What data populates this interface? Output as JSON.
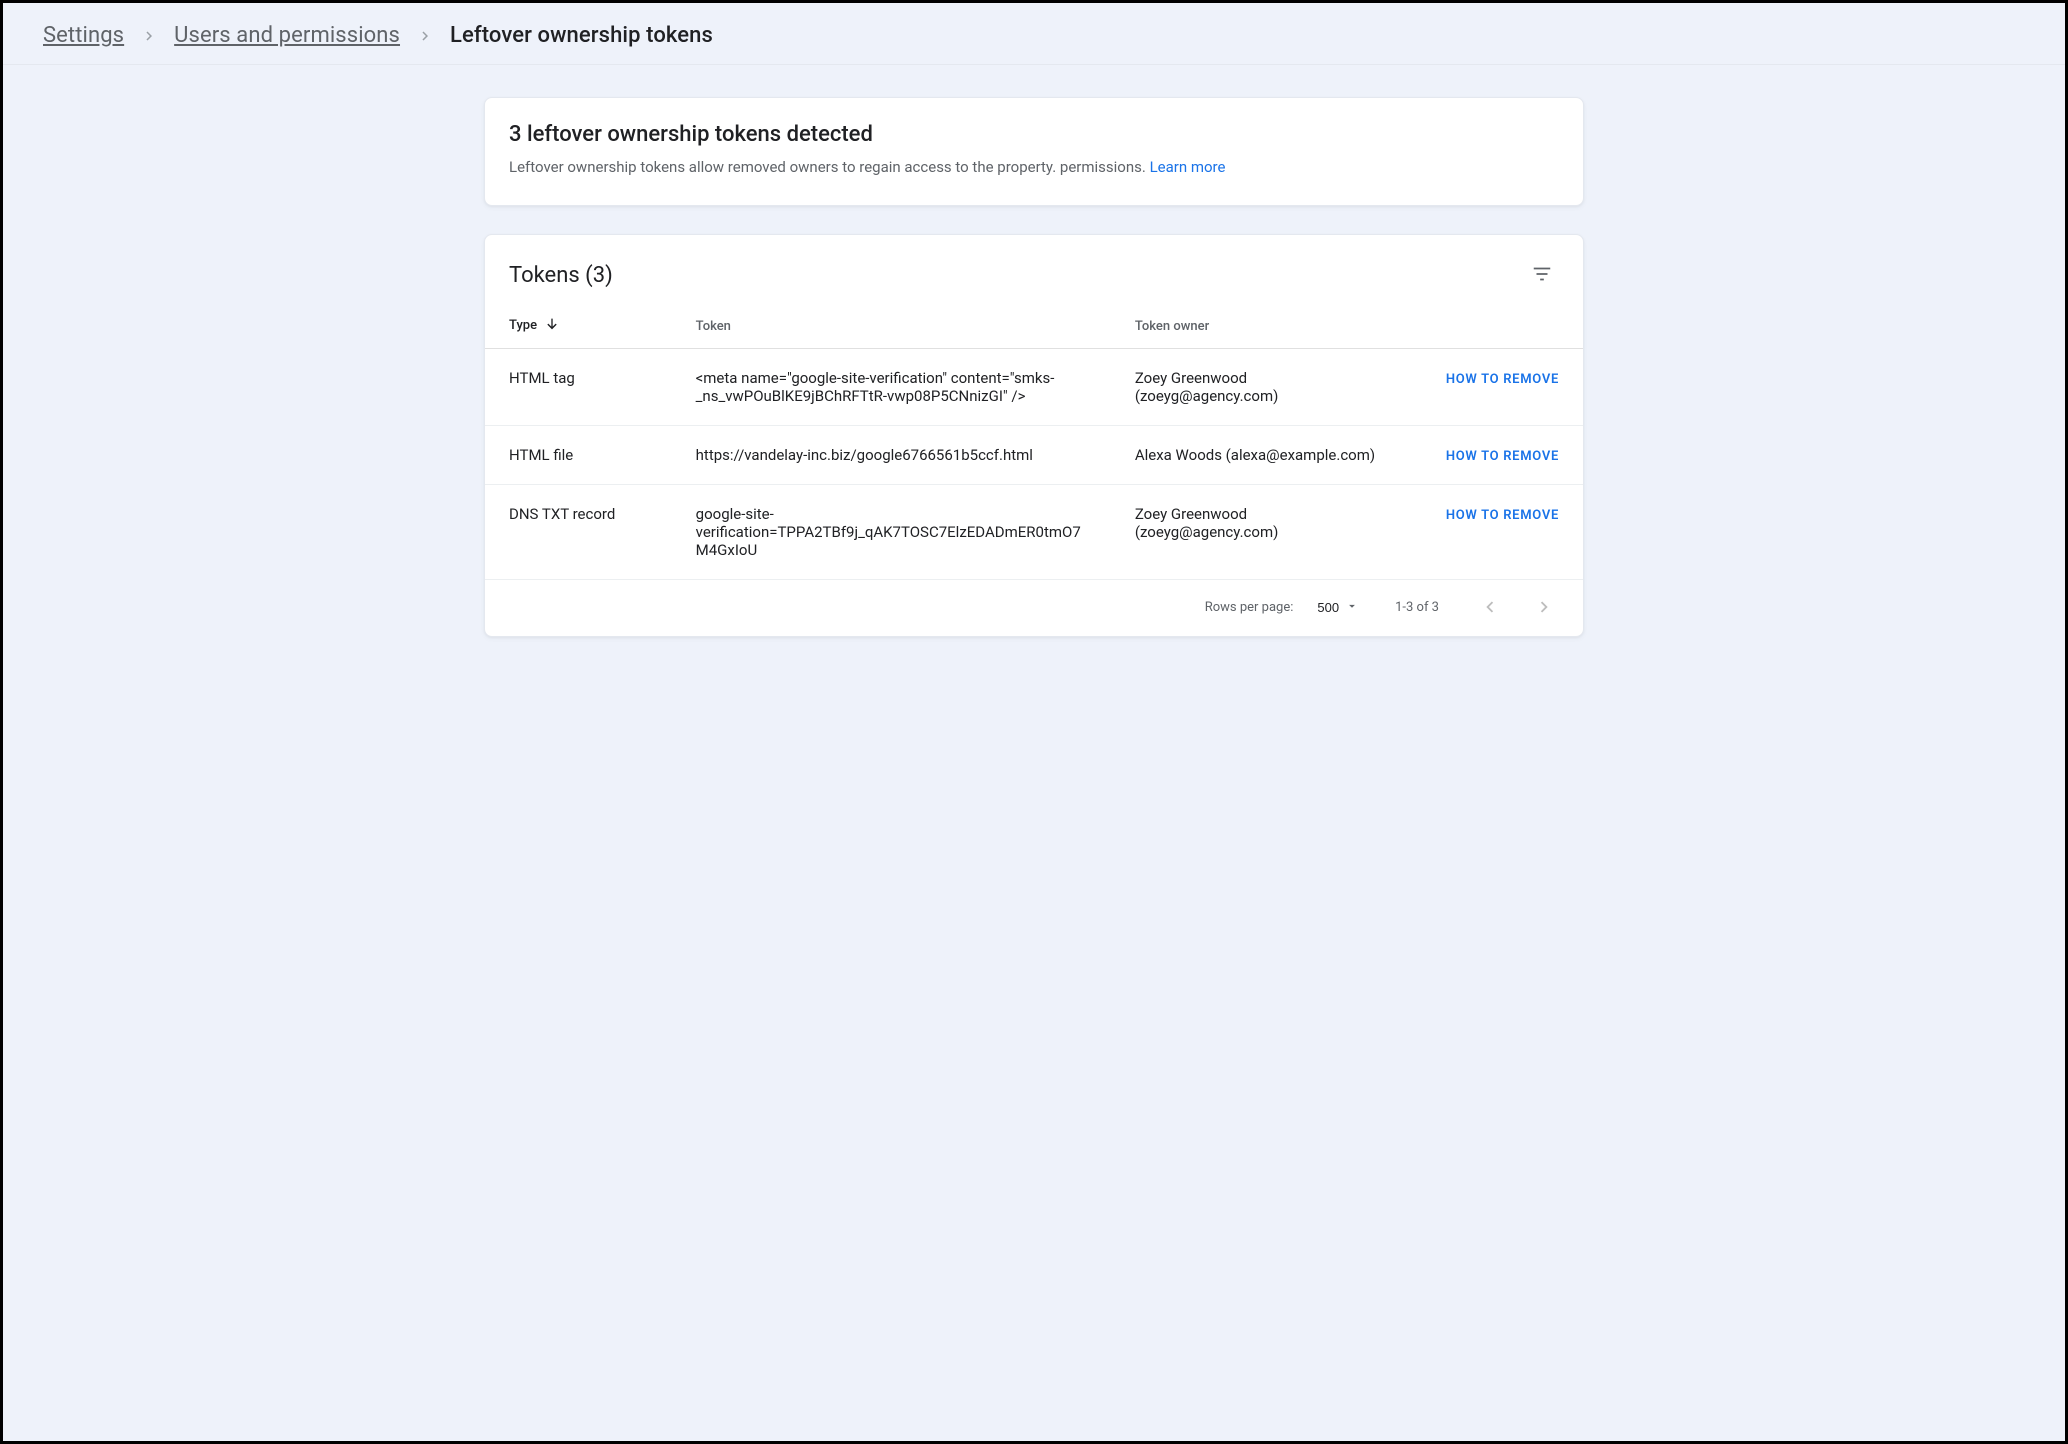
{
  "breadcrumb": {
    "items": [
      {
        "label": "Settings"
      },
      {
        "label": "Users and permissions"
      },
      {
        "label": "Leftover ownership tokens"
      }
    ]
  },
  "notice": {
    "heading": "3 leftover ownership tokens detected",
    "body": "Leftover ownership tokens allow removed owners to regain access to the property. permissions. ",
    "learn_more": "Learn more"
  },
  "tokens": {
    "title": "Tokens (3)",
    "columns": {
      "type": "Type",
      "token": "Token",
      "owner": "Token owner"
    },
    "action_label": "HOW TO REMOVE",
    "rows": [
      {
        "type": "HTML tag",
        "token": "<meta name=\"google-site-verification\" content=\"smks-_ns_vwPOuBlKE9jBChRFTtR-vwp08P5CNnizGI\" />",
        "owner": "Zoey Greenwood (zoeyg@agency.com)"
      },
      {
        "type": "HTML file",
        "token": "https://vandelay-inc.biz/google6766561b5ccf.html",
        "owner": "Alexa Woods (alexa@example.com)"
      },
      {
        "type": "DNS TXT record",
        "token": "google-site-verification=TPPA2TBf9j_qAK7TOSC7ElzEDADmER0tmO7M4GxIoU",
        "owner": "Zoey Greenwood (zoeyg@agency.com)"
      }
    ]
  },
  "pagination": {
    "rows_per_page_label": "Rows per page:",
    "rows_per_page_value": "500",
    "range_text": "1-3 of 3"
  }
}
